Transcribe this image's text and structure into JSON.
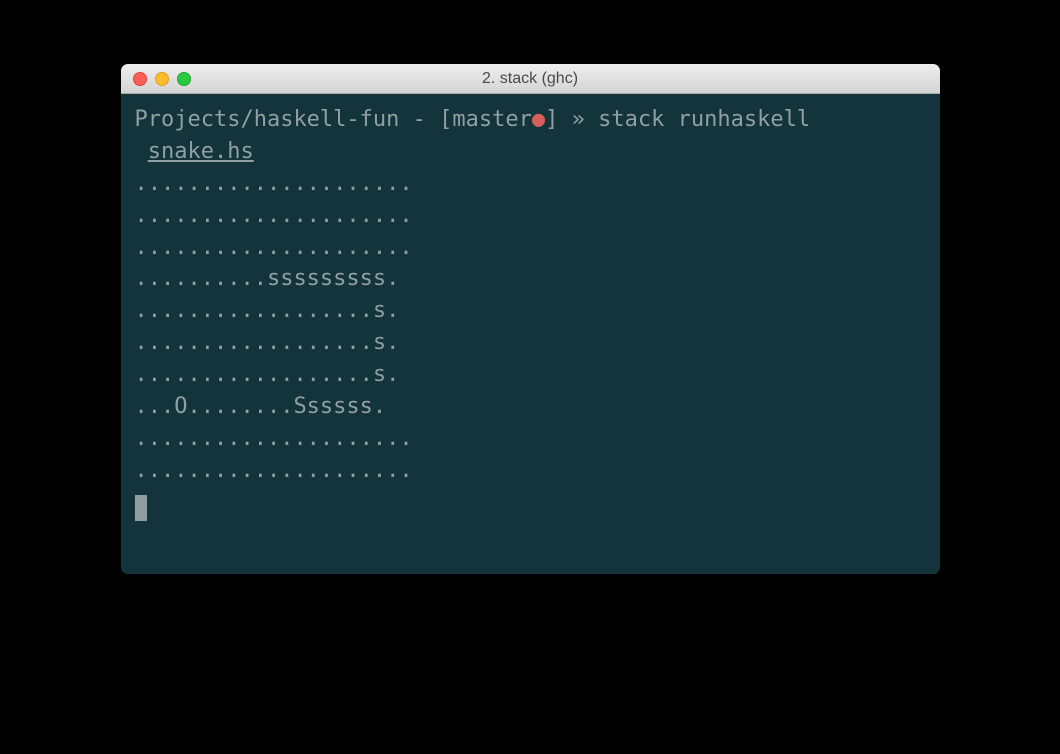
{
  "window": {
    "title": "2. stack (ghc)"
  },
  "prompt": {
    "path": "Projects/haskell-fun",
    "sep": " - ",
    "branch_open": "[",
    "branch": "master",
    "dirty": "●",
    "branch_close": "]",
    "arrow": " » ",
    "command": "stack runhaskell",
    "indent": " ",
    "filename": "snake.hs"
  },
  "output": {
    "lines": [
      ".....................",
      ".....................",
      ".....................",
      "..........sssssssss.",
      "..................s.",
      "..................s.",
      "..................s.",
      "...O........Ssssss.",
      ".....................",
      "....................."
    ]
  }
}
